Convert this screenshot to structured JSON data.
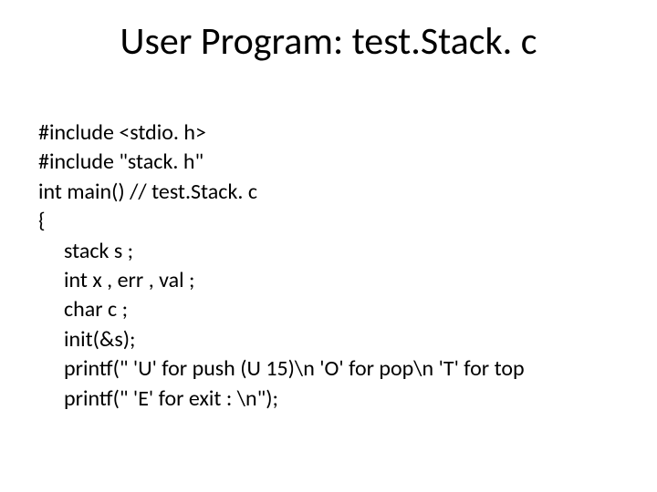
{
  "title": "User Program: test.Stack. c",
  "code": {
    "l1": "#include <stdio. h>",
    "l2": "#include \"stack. h\"",
    "l3": "int main()  // test.Stack. c",
    "l4": "{",
    "l5": "stack s ;",
    "l6": "int x , err , val ;",
    "l7": "char c ;",
    "l8": "init(&s);",
    "l9": "printf(\" 'U' for push (U 15)\\n 'O' for pop\\n 'T' for top",
    "l10": "printf(\" 'E' for exit : \\n\");"
  }
}
